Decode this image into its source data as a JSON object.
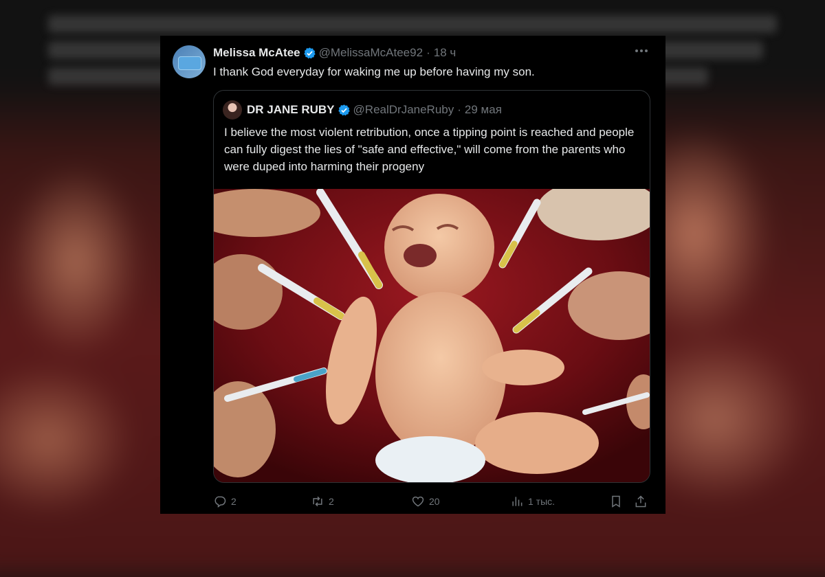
{
  "tweet": {
    "author_name": "Melissa McAtee",
    "handle": "@MelissaMcAtee92",
    "separator": "·",
    "time": "18 ч",
    "text": "I thank God everyday for waking me up before having my son."
  },
  "quoted": {
    "author_name": "DR JANE RUBY",
    "handle": "@RealDrJaneRuby",
    "separator": "·",
    "time": "29 мая",
    "text": "I believe the most violent retribution, once a tipping point is reached and people can fully digest the lies of \"safe and effective,\" will come from the parents who were duped into harming their progeny"
  },
  "actions": {
    "replies": "2",
    "retweets": "2",
    "likes": "20",
    "views": "1 тыс."
  },
  "colors": {
    "background": "#000000",
    "text": "#e7e9ea",
    "muted": "#71767b",
    "verified": "#1d9bf0",
    "border": "#2f3336",
    "image_bg": "#6e0c12"
  },
  "icons": [
    "verified-badge-icon",
    "more-icon",
    "reply-icon",
    "retweet-icon",
    "like-icon",
    "views-icon",
    "bookmark-icon",
    "share-icon"
  ]
}
